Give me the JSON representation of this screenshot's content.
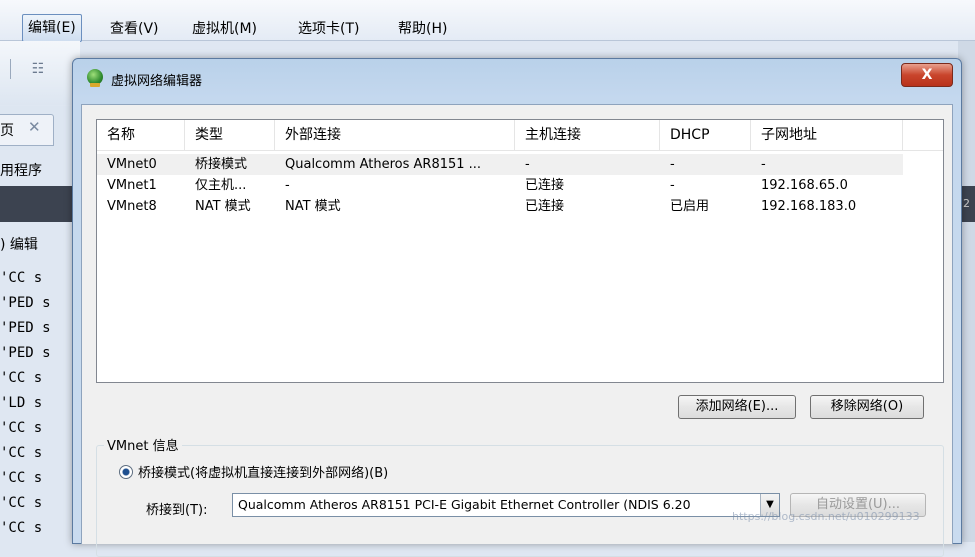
{
  "menubar": {
    "items": [
      "编辑(E)",
      "查看(V)",
      "虚拟机(M)",
      "选项卡(T)",
      "帮助(H)"
    ]
  },
  "background": {
    "tab_text": "页",
    "app_label": "用程序",
    "edit_label": ") 编辑",
    "terminal_rows": [
      "'CC  s",
      "'PED s",
      "'PED s",
      "'PED s",
      "'CC  s",
      "'LD  s",
      "'CC  s",
      "'CC  s",
      "'CC  s",
      "'CC  s",
      "'CC  s"
    ],
    "right_edge_char": "2"
  },
  "dialog": {
    "title": "虚拟网络编辑器",
    "close_label": "X",
    "table": {
      "headers": [
        "名称",
        "类型",
        "外部连接",
        "主机连接",
        "DHCP",
        "子网地址"
      ],
      "rows": [
        [
          "VMnet0",
          "桥接模式",
          "Qualcomm Atheros AR8151 ...",
          "-",
          "-",
          "-"
        ],
        [
          "VMnet1",
          "仅主机...",
          "-",
          "已连接",
          "-",
          "192.168.65.0"
        ],
        [
          "VMnet8",
          "NAT 模式",
          "NAT 模式",
          "已连接",
          "已启用",
          "192.168.183.0"
        ]
      ]
    },
    "add_network_label": "添加网络(E)...",
    "remove_network_label": "移除网络(O)",
    "vmnet_info_label": "VMnet 信息",
    "bridge_radio_label": "桥接模式(将虚拟机直接连接到外部网络)(B)",
    "bridge_to_label": "桥接到(T):",
    "bridge_to_value": "Qualcomm Atheros AR8151 PCI-E Gigabit Ethernet Controller (NDIS 6.20",
    "auto_settings_label": "自动设置(U)..."
  },
  "watermark": "https://blog.csdn.net/u010299133",
  "colors": {
    "title_bar": "#c4d8ee",
    "close_button": "#c9452c",
    "client_bg": "#f0f0f0"
  }
}
